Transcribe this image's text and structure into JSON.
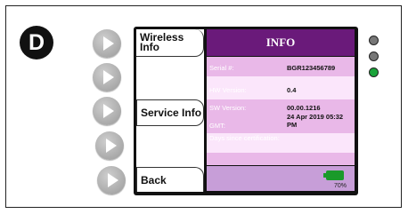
{
  "device": {
    "badge": "D"
  },
  "softkeys": {
    "wireless": "Wireless Info",
    "service": "Service Info",
    "back": "Back"
  },
  "info": {
    "title": "INFO",
    "rows": [
      {
        "label": "Serial #:",
        "value": "BGR123456789"
      },
      {
        "label": "HW Version:",
        "value": "0.4"
      },
      {
        "label": "SW Version:",
        "value": "00.00.1216"
      },
      {
        "label": "GMT:",
        "value": "24 Apr 2019 05:32 PM"
      },
      {
        "label": "Days since certification:",
        "value": ""
      }
    ]
  },
  "battery": {
    "percent_label": "70%",
    "level": 0.7,
    "color": "#1a9a2a"
  },
  "leds": [
    {
      "name": "led-1",
      "color": "#777777"
    },
    {
      "name": "led-2",
      "color": "#777777"
    },
    {
      "name": "led-3",
      "color": "#1aa33a"
    }
  ],
  "colors": {
    "header": "#6a1a7a",
    "row_alt": "#e9b8e8",
    "row_light": "#fbe6fb",
    "footer": "#c79ed8"
  }
}
